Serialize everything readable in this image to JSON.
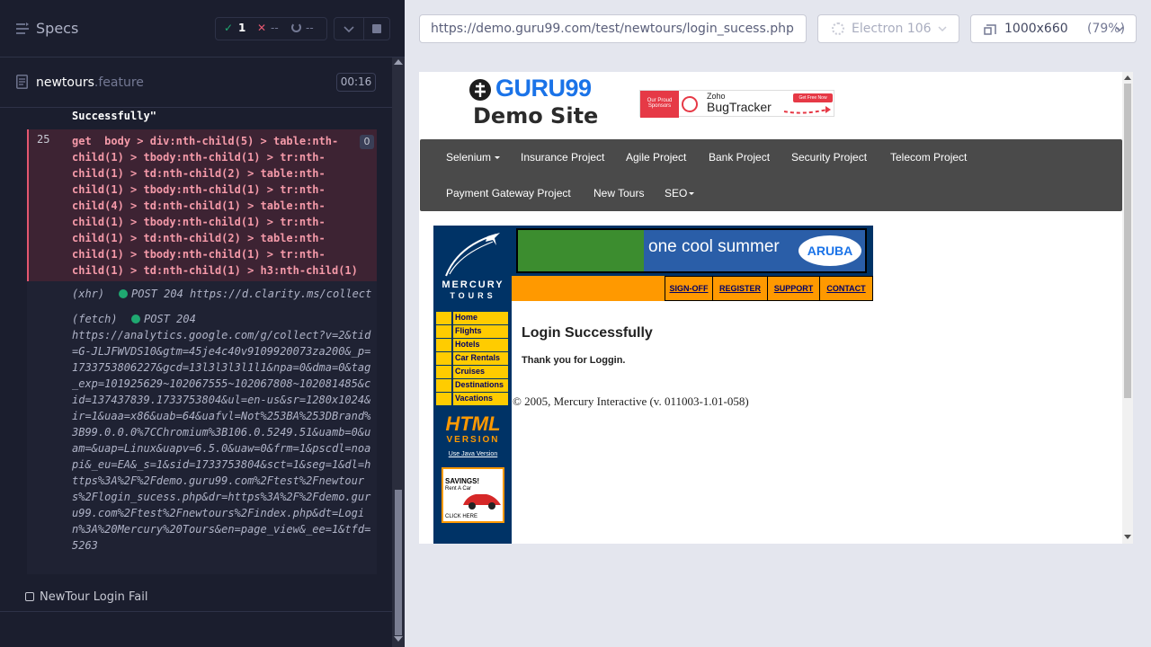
{
  "reporter": {
    "title": "Specs",
    "stats": {
      "passed": "1",
      "failed": "--",
      "pending": "--"
    },
    "spec_file": {
      "name": "newtours",
      "ext": ".feature",
      "duration": "00:16"
    },
    "prev_line": "Successfully\"",
    "command": {
      "number": "25",
      "name": "get",
      "selector": "body > div:nth-child(5) > table:nth-\nchild(1) > tbody:nth-child(1) > tr:nth-\nchild(1) > td:nth-child(2) > table:nth-\nchild(1) > tbody:nth-child(1) > tr:nth-\nchild(4) > td:nth-child(1) > table:nth-\nchild(1) > tbody:nth-child(1) > tr:nth-\nchild(1) > td:nth-child(2) > table:nth-\nchild(1) > tbody:nth-child(1) > tr:nth-\nchild(1) > td:nth-child(1) > h3:nth-child(1)",
      "badge": "0"
    },
    "xhr": {
      "kind": "(xhr)",
      "method": "POST 204",
      "url": "https://d.clarity.ms/collect"
    },
    "fetch": {
      "kind": "(fetch)",
      "method": "POST 204",
      "url": "https://analytics.google.com/g/collect?v=2&tid=G-JLJFWVDS10&gtm=45je4c40v9109920073za200&_p=1733753806227&gcd=13l3l3l3l1l1&npa=0&dma=0&tag_exp=101925629~102067555~102067808~102081485&cid=137437839.1733753804&ul=en-us&sr=1280x1024&ir=1&uaa=x86&uab=64&uafvl=Not%253BA%253DBrand%3B99.0.0.0%7CChromium%3B106.0.5249.51&uamb=0&uam=&uap=Linux&uapv=6.5.0&uaw=0&frm=1&pscdl=noapi&_eu=EA&_s=1&sid=1733753804&sct=1&seg=1&dl=https%3A%2F%2Fdemo.guru99.com%2Ftest%2Fnewtours%2Flogin_sucess.php&dr=https%3A%2F%2Fdemo.guru99.com%2Ftest%2Fnewtours%2Findex.php&dt=Login%3A%20Mercury%20Tours&en=page_view&_ee=1&tfd=5263"
    },
    "next_test": "NewTour Login Fail"
  },
  "header": {
    "url": "https://demo.guru99.com/test/newtours/login_sucess.php",
    "browser": "Electron 106",
    "viewport": "1000x660",
    "zoom": "(79%)"
  },
  "aut": {
    "logo_name": "GURU99",
    "logo_sub": "Demo Site",
    "sponsor": {
      "tag": "Our Proud Sponsors",
      "brand_top": "Zoho",
      "brand": "BugTracker",
      "cta": "Get Free Now"
    },
    "nav": [
      "Selenium",
      "Insurance Project",
      "Agile Project",
      "Bank Project",
      "Security Project",
      "Telecom Project",
      "Payment Gateway Project",
      "New Tours",
      "SEO"
    ],
    "mercury": {
      "brand_top": "MERCURY",
      "brand_bottom": "TOURS",
      "banner_text": "one cool summer",
      "banner_badge": "ARUBA",
      "top_links": [
        "SIGN-OFF",
        "REGISTER",
        "SUPPORT",
        "CONTACT"
      ],
      "side_links": [
        "Home",
        "Flights",
        "Hotels",
        "Car Rentals",
        "Cruises",
        "Destinations",
        "Vacations"
      ],
      "html_version": "HTML",
      "version": "VERSION",
      "java_link": "Use Java Version",
      "ad": {
        "title": "SAVINGS!",
        "sub": "Rent A Car",
        "cta": "CLICK HERE"
      },
      "heading": "Login Successfully",
      "message": "Thank you for Loggin.",
      "copyright": "© 2005, Mercury Interactive (v. 011003-1.01-058)"
    }
  }
}
